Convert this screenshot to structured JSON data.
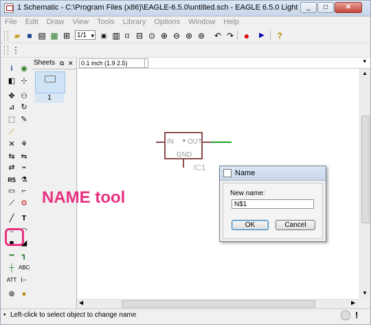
{
  "window": {
    "title": "1 Schematic - C:\\Program Files (x86)\\EAGLE-6.5.0\\untitled.sch - EAGLE 6.5.0 Light",
    "min": "_",
    "max": "□",
    "close": "✕"
  },
  "menu": [
    "File",
    "Edit",
    "Draw",
    "View",
    "Tools",
    "Library",
    "Options",
    "Window",
    "Help"
  ],
  "toolbar": {
    "grid_combo": "1/1",
    "help": "?"
  },
  "sheets_panel": {
    "title": "Sheets",
    "page_number": "1"
  },
  "coordinate": "0.1 inch (1.9 2.5)",
  "schematic": {
    "pin_in": "IN",
    "pin_out": "OUT",
    "pin_gnd": "GND",
    "plus": "+",
    "part_name": "IC1"
  },
  "annotation": "NAME tool",
  "dialog": {
    "title": "Name",
    "label": "New name:",
    "value": "N$1",
    "ok": "OK",
    "cancel": "Cancel"
  },
  "status": "Left-click to select object to change name",
  "colors": {
    "accent": "#e8317f",
    "wire": "#1aa31a",
    "symbol": "#8a4b4b"
  }
}
